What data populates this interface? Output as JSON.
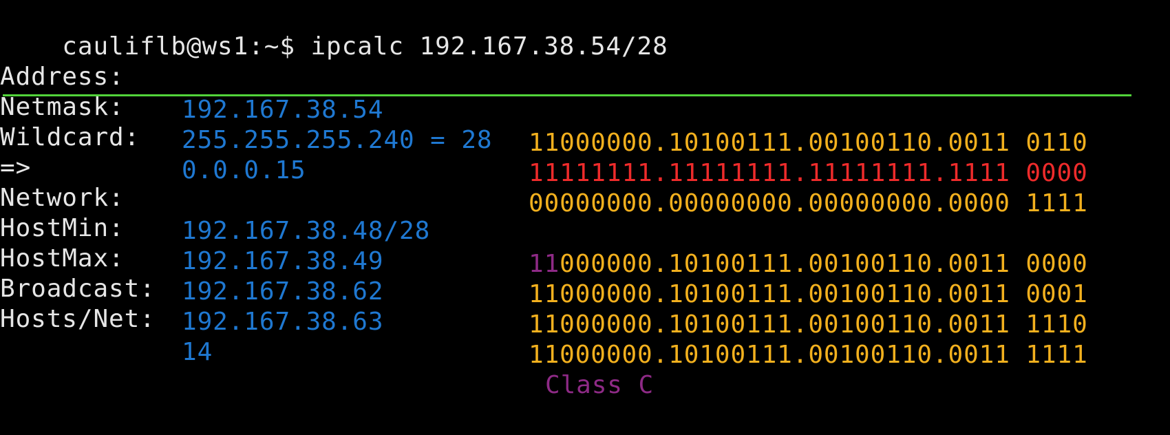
{
  "terminal": {
    "prompt": "cauliflb@ws1:~$ ",
    "command": "ipcalc 192.167.38.54/28"
  },
  "rows": {
    "address": {
      "label": "Address:",
      "value": "192.167.38.54",
      "binary": "11000000.10100111.00100110.0011 0110"
    },
    "netmask": {
      "label": "Netmask:",
      "value": "255.255.255.240 = 28",
      "binary": "11111111.11111111.11111111.1111 0000"
    },
    "wildcard": {
      "label": "Wildcard:",
      "value": "0.0.0.15",
      "binary": "00000000.00000000.00000000.0000 1111"
    },
    "arrow": "=>",
    "network": {
      "label": "Network:",
      "value": "192.167.38.48/28",
      "binary_prefix": "11",
      "binary_rest": "000000.10100111.00100110.0011 0000"
    },
    "hostmin": {
      "label": "HostMin:",
      "value": "192.167.38.49",
      "binary": "11000000.10100111.00100110.0011 0001"
    },
    "hostmax": {
      "label": "HostMax:",
      "value": "192.167.38.62",
      "binary": "11000000.10100111.00100110.0011 1110"
    },
    "broadcast": {
      "label": "Broadcast:",
      "value": "192.167.38.63",
      "binary": "11000000.10100111.00100110.0011 1111"
    },
    "hosts": {
      "label": "Hosts/Net:",
      "value": "14",
      "class": "Class C"
    }
  },
  "colors": {
    "background": "#000000",
    "text": "#e6e6e6",
    "value": "#1f78d1",
    "binary": "#f2b01e",
    "netmask_binary": "#ee2b2b",
    "class": "#8e2a86",
    "rule": "#52d43a"
  }
}
